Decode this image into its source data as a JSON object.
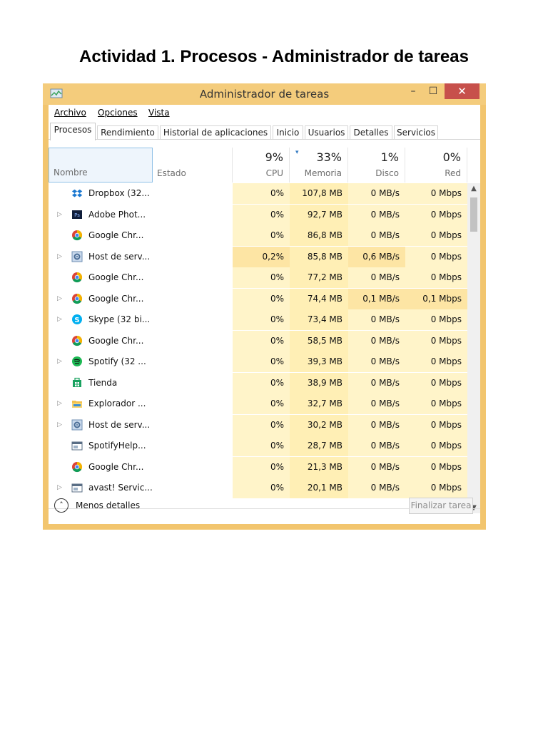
{
  "document": {
    "title": "Actividad 1. Procesos - Administrador de tareas"
  },
  "window": {
    "title": "Administrador de tareas",
    "controls": {
      "minimize": "–",
      "maximize": "☐",
      "close": "✕"
    }
  },
  "menu": [
    "Archivo",
    "Opciones",
    "Vista"
  ],
  "tabs": [
    "Procesos",
    "Rendimiento",
    "Historial de aplicaciones",
    "Inicio",
    "Usuarios",
    "Detalles",
    "Servicios"
  ],
  "active_tab": "Procesos",
  "columns": {
    "name": "Nombre",
    "status": "Estado",
    "cpu": {
      "pct": "9%",
      "label": "CPU"
    },
    "memory": {
      "pct": "33%",
      "label": "Memoria"
    },
    "disk": {
      "pct": "1%",
      "label": "Disco"
    },
    "network": {
      "pct": "0%",
      "label": "Red"
    }
  },
  "processes": [
    {
      "name": "Dropbox (32...",
      "icon": "dropbox-icon",
      "expandable": false,
      "cpu": "0%",
      "mem": "107,8 MB",
      "disk": "0 MB/s",
      "net": "0 Mbps"
    },
    {
      "name": "Adobe Phot...",
      "icon": "photoshop-icon",
      "expandable": true,
      "cpu": "0%",
      "mem": "92,7 MB",
      "disk": "0 MB/s",
      "net": "0 Mbps"
    },
    {
      "name": "Google Chr...",
      "icon": "chrome-icon",
      "expandable": false,
      "cpu": "0%",
      "mem": "86,8 MB",
      "disk": "0 MB/s",
      "net": "0 Mbps"
    },
    {
      "name": "Host de serv...",
      "icon": "service-host-icon",
      "expandable": true,
      "cpu": "0,2%",
      "mem": "85,8 MB",
      "disk": "0,6 MB/s",
      "net": "0 Mbps"
    },
    {
      "name": "Google Chr...",
      "icon": "chrome-icon",
      "expandable": false,
      "cpu": "0%",
      "mem": "77,2 MB",
      "disk": "0 MB/s",
      "net": "0 Mbps"
    },
    {
      "name": "Google Chr...",
      "icon": "chrome-icon",
      "expandable": true,
      "cpu": "0%",
      "mem": "74,4 MB",
      "disk": "0,1 MB/s",
      "net": "0,1 Mbps"
    },
    {
      "name": "Skype (32 bi...",
      "icon": "skype-icon",
      "expandable": true,
      "cpu": "0%",
      "mem": "73,4 MB",
      "disk": "0 MB/s",
      "net": "0 Mbps"
    },
    {
      "name": "Google Chr...",
      "icon": "chrome-icon",
      "expandable": false,
      "cpu": "0%",
      "mem": "58,5 MB",
      "disk": "0 MB/s",
      "net": "0 Mbps"
    },
    {
      "name": "Spotify (32 ...",
      "icon": "spotify-icon",
      "expandable": true,
      "cpu": "0%",
      "mem": "39,3 MB",
      "disk": "0 MB/s",
      "net": "0 Mbps"
    },
    {
      "name": "Tienda",
      "icon": "store-icon",
      "expandable": false,
      "cpu": "0%",
      "mem": "38,9 MB",
      "disk": "0 MB/s",
      "net": "0 Mbps"
    },
    {
      "name": "Explorador ...",
      "icon": "explorer-icon",
      "expandable": true,
      "cpu": "0%",
      "mem": "32,7 MB",
      "disk": "0 MB/s",
      "net": "0 Mbps"
    },
    {
      "name": "Host de serv...",
      "icon": "service-host-icon",
      "expandable": true,
      "cpu": "0%",
      "mem": "30,2 MB",
      "disk": "0 MB/s",
      "net": "0 Mbps"
    },
    {
      "name": "SpotifyHelp...",
      "icon": "app-window-icon",
      "expandable": false,
      "cpu": "0%",
      "mem": "28,7 MB",
      "disk": "0 MB/s",
      "net": "0 Mbps"
    },
    {
      "name": "Google Chr...",
      "icon": "chrome-icon",
      "expandable": false,
      "cpu": "0%",
      "mem": "21,3 MB",
      "disk": "0 MB/s",
      "net": "0 Mbps"
    },
    {
      "name": "avast! Servic...",
      "icon": "app-window-icon",
      "expandable": true,
      "cpu": "0%",
      "mem": "20,1 MB",
      "disk": "0 MB/s",
      "net": "0 Mbps"
    }
  ],
  "footer": {
    "fewer_details": "Menos detalles",
    "end_task": "Finalizar tarea"
  },
  "colors": {
    "frame": "#f2c56e",
    "heat_light": "#fff4c9",
    "heat_mid": "#ffefb5",
    "heat_strong": "#fde5a4",
    "selected_header": "#eef5fc"
  }
}
